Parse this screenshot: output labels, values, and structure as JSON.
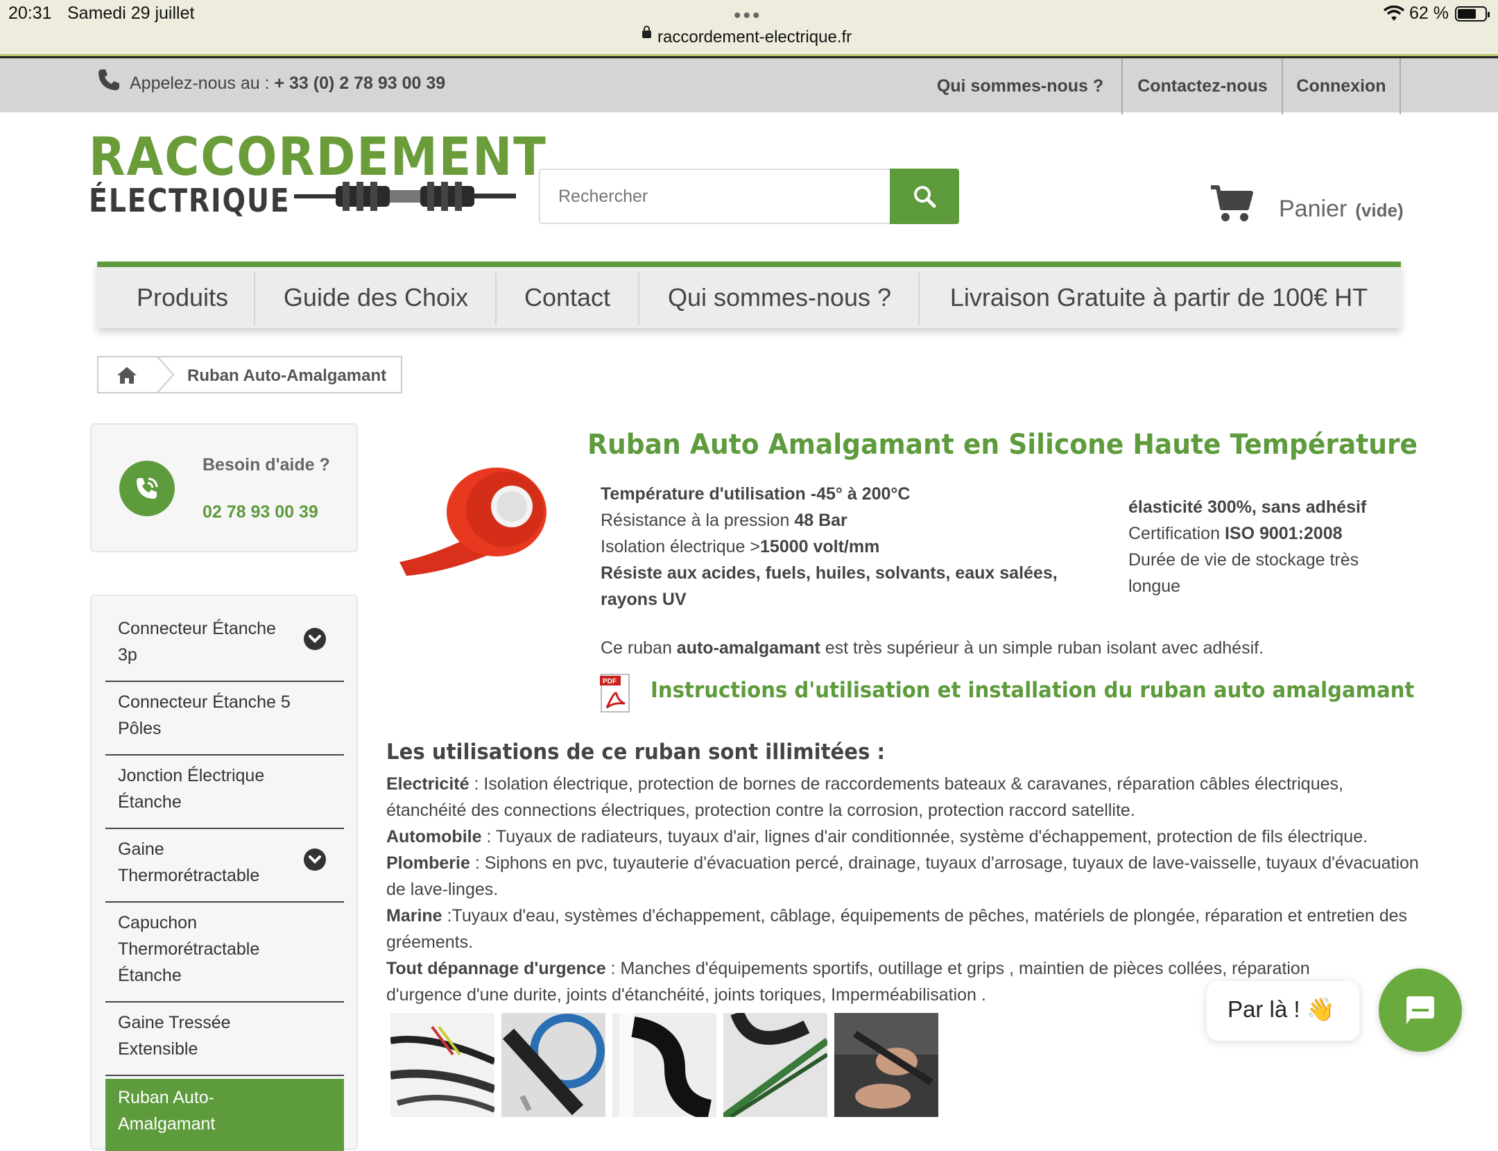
{
  "status_bar": {
    "time": "20:31",
    "date": "Samedi 29 juillet",
    "battery": "62 %",
    "url": "raccordement-electrique.fr"
  },
  "topbar": {
    "call_label": "Appelez-nous au : ",
    "call_number": "+ 33 (0) 2 78 93 00 39",
    "links": [
      "Qui sommes-nous ?",
      "Contactez-nous",
      "Connexion"
    ]
  },
  "header": {
    "logo_line1": "RACCORDEMENT",
    "logo_line2": "ÉLECTRIQUE",
    "search_placeholder": "Rechercher",
    "cart_label": "Panier",
    "cart_state": "(vide)"
  },
  "nav": [
    "Produits",
    "Guide des Choix",
    "Contact",
    "Qui sommes-nous ?",
    "Livraison Gratuite à partir de 100€ HT"
  ],
  "breadcrumb": {
    "current": "Ruban Auto-Amalgamant"
  },
  "help": {
    "title": "Besoin d'aide ?",
    "phone": "02 78 93 00 39"
  },
  "categories": [
    {
      "label": "Connecteur Étanche 3p",
      "expandable": true
    },
    {
      "label": "Connecteur Étanche 5 Pôles",
      "expandable": false
    },
    {
      "label": "Jonction Électrique Étanche",
      "expandable": false
    },
    {
      "label": "Gaine Thermorétractable",
      "expandable": true
    },
    {
      "label": "Capuchon Thermorétractable Étanche",
      "expandable": false
    },
    {
      "label": "Gaine Tressée Extensible",
      "expandable": false
    },
    {
      "label": "Ruban Auto-Amalgamant",
      "expandable": false,
      "active": true
    }
  ],
  "product": {
    "title": "Ruban Auto Amalgamant en Silicone Haute Température",
    "specs_left": {
      "temp": "Température d'utilisation -45° à 200°C",
      "pressure_label": "Résistance à la pression ",
      "pressure_value": "48 Bar",
      "iso_label": "Isolation électrique >",
      "iso_value": "15000 volt/mm",
      "resist": "Résiste aux acides, fuels, huiles, solvants, eaux salées, rayons UV"
    },
    "specs_right": {
      "elastic": "élasticité 300%, sans adhésif",
      "cert_label": "Certification ",
      "cert_value": "ISO 9001:2008",
      "storage": " Durée de vie de stockage très longue"
    },
    "desc_pre": "Ce ruban ",
    "desc_bold": "auto-amalgamant",
    "desc_post": " est très supérieur à un simple ruban isolant avec adhésif.",
    "pdf_link": "Instructions d'utilisation et installation du ruban auto amalgamant",
    "pdf_icon_text": "PDF"
  },
  "uses": {
    "title": "Les utilisations de ce ruban sont illimitées :",
    "items": [
      {
        "label": "Electricité",
        "text": " : Isolation électrique, protection de bornes de raccordements bateaux & caravanes, réparation câbles électriques, étanchéité des connections électriques, protection contre la corrosion, protection raccord satellite."
      },
      {
        "label": "Automobile",
        "text": " : Tuyaux de radiateurs, tuyaux d'air, lignes d'air conditionnée, système d'échappement, protection de fils électrique."
      },
      {
        "label": "Plomberie",
        "text": " : Siphons en pvc, tuyauterie d'évacuation percé, drainage, tuyaux d'arrosage, tuyaux de lave-vaisselle, tuyaux d'évacuation de lave-linges."
      },
      {
        "label": "Marine",
        "text": " :Tuyaux d'eau, systèmes d'échappement, câblage, équipements de pêches, matériels de plongée, réparation et entretien des gréements."
      },
      {
        "label": "Tout dépannage d'urgence",
        "text": " : Manches d'équipements sportifs, outillage et grips , maintien de pièces collées, réparation d'urgence d'une durite, joints d'étanchéité, joints toriques,  Imperméabilisation ."
      }
    ]
  },
  "chat": {
    "teaser": "Par là ! 👋"
  },
  "colors": {
    "accent": "#5d9b3c",
    "topbar": "#d5d5d5",
    "text": "#444444"
  }
}
